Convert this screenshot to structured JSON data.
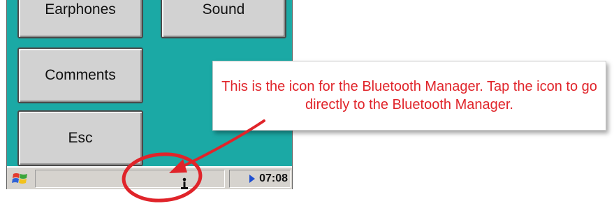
{
  "buttons": {
    "earphones": "Earphones",
    "sound": "Sound",
    "comments": "Comments",
    "esc": "Esc"
  },
  "taskbar": {
    "start_icon": "windows-flag-icon",
    "bluetooth_icon": "bluetooth-manager-icon",
    "tray_arrow_icon": "tray-arrow-icon",
    "clock": "07:08"
  },
  "callout": {
    "text": "This is the icon for the Bluetooth Manager. Tap the icon to go directly to the Bluetooth Manager."
  },
  "colors": {
    "screen_bg": "#1ba9a5",
    "annotation_red": "#e0242a",
    "taskbar_bg": "#d6d3ce"
  }
}
